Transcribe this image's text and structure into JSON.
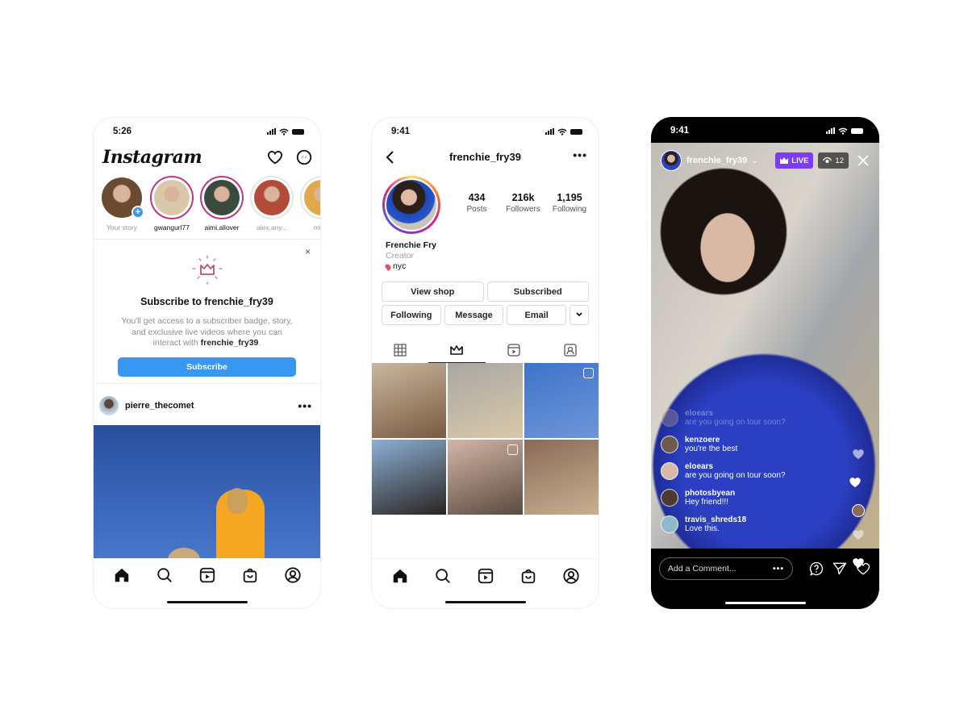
{
  "feed_screen": {
    "status_time": "5:26",
    "app_logo": "Instagram",
    "header_icons": [
      "heart-icon",
      "messenger-icon"
    ],
    "stories": [
      {
        "name": "Your story",
        "own": true,
        "color": "#6b4a32"
      },
      {
        "name": "gwangurl77",
        "own": false,
        "seen": false,
        "color": "#d9c9a8"
      },
      {
        "name": "aimi.allover",
        "own": false,
        "seen": false,
        "color": "#3a4a3c"
      },
      {
        "name": "alex.any...",
        "own": false,
        "seen": true,
        "color": "#b34a3a"
      },
      {
        "name": "mis...",
        "own": false,
        "seen": true,
        "color": "#e0a84a"
      }
    ],
    "subscribe_card": {
      "title": "Subscribe to frenchie_fry39",
      "description_prefix": "You'll get access to a subscriber badge, story, and exclusive live videos where you can interact with ",
      "description_user": "frenchie_fry39",
      "description_suffix": ".",
      "button_label": "Subscribe",
      "close_label": "×"
    },
    "post": {
      "username": "pierre_thecomet",
      "more_label": "•••"
    },
    "tab_bar": [
      "home-icon",
      "search-icon",
      "reels-icon",
      "shop-icon",
      "profile-icon"
    ]
  },
  "profile_screen": {
    "status_time": "9:41",
    "username": "frenchie_fry39",
    "more_label": "•••",
    "stats": [
      {
        "value": "434",
        "label": "Posts"
      },
      {
        "value": "216k",
        "label": "Followers"
      },
      {
        "value": "1,195",
        "label": "Following"
      }
    ],
    "bio": {
      "name": "Frenchie Fry",
      "category": "Creator",
      "location": "nyc"
    },
    "buttons_row1": [
      "View shop",
      "Subscribed"
    ],
    "buttons_row2": [
      "Following",
      "Message",
      "Email"
    ],
    "chevron_label": "⌄",
    "tabs": [
      {
        "name": "grid",
        "active": false
      },
      {
        "name": "subscriber-crown",
        "active": true
      },
      {
        "name": "reels",
        "active": false
      },
      {
        "name": "tagged",
        "active": false
      }
    ],
    "grid_cells": [
      {
        "colors": [
          "#c8b79f",
          "#7a5a40"
        ],
        "badge": false
      },
      {
        "colors": [
          "#a8a8a4",
          "#d9c8a8"
        ],
        "badge": false
      },
      {
        "colors": [
          "#3f73c9",
          "#6e96d8"
        ],
        "badge": true
      },
      {
        "colors": [
          "#8cb0d6",
          "#2a2420"
        ],
        "badge": false
      },
      {
        "colors": [
          "#d4b6a8",
          "#5a4a40"
        ],
        "badge": true
      },
      {
        "colors": [
          "#8a6a58",
          "#c8b090"
        ],
        "badge": false
      }
    ]
  },
  "live_screen": {
    "status_time": "9:41",
    "username": "frenchie_fry39",
    "live_label": "LIVE",
    "viewer_count": "12",
    "comments": [
      {
        "user": "eloears",
        "text": "are you going on tour soon?",
        "faded": true,
        "color": "#bfa08a"
      },
      {
        "user": "kenzoere",
        "text": "you're the best",
        "faded": false,
        "color": "#6d5b4b"
      },
      {
        "user": "eloears",
        "text": "are you going on tour soon?",
        "faded": false,
        "color": "#d8b8a8"
      },
      {
        "user": "photosbyean",
        "text": "Hey friend!!!",
        "faded": false,
        "color": "#4a3a30"
      },
      {
        "user": "travis_shreds18",
        "text": "Love this.",
        "faded": false,
        "color": "#8fb8c8"
      }
    ],
    "comment_placeholder": "Add a Comment...",
    "comment_more": "•••",
    "actions": [
      "question-icon",
      "send-icon",
      "heart-icon"
    ]
  }
}
